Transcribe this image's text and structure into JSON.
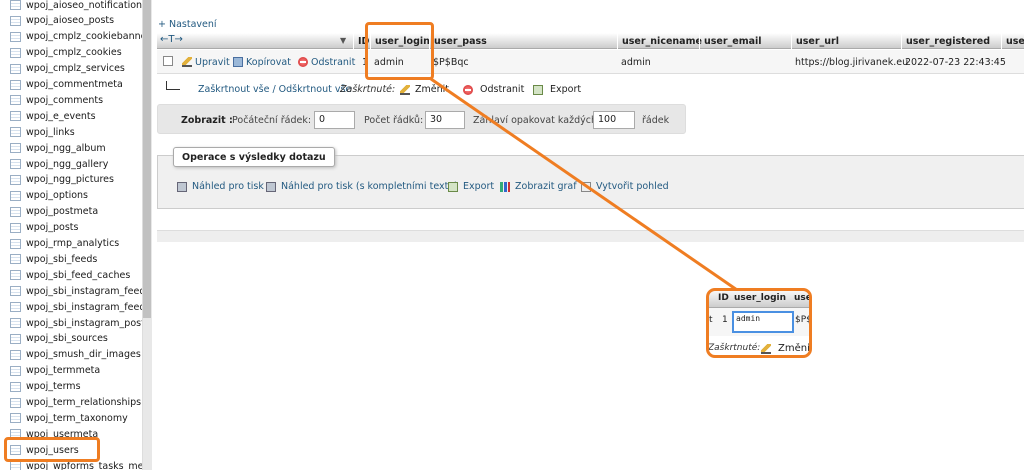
{
  "sidebar": {
    "tables": [
      "wpoj_aioseo_notifications",
      "wpoj_aioseo_posts",
      "wpoj_cmplz_cookiebanners",
      "wpoj_cmplz_cookies",
      "wpoj_cmplz_services",
      "wpoj_commentmeta",
      "wpoj_comments",
      "wpoj_e_events",
      "wpoj_links",
      "wpoj_ngg_album",
      "wpoj_ngg_gallery",
      "wpoj_ngg_pictures",
      "wpoj_options",
      "wpoj_postmeta",
      "wpoj_posts",
      "wpoj_rmp_analytics",
      "wpoj_sbi_feeds",
      "wpoj_sbi_feed_caches",
      "wpoj_sbi_instagram_feeds",
      "wpoj_sbi_instagram_feed_",
      "wpoj_sbi_instagram_posts",
      "wpoj_sbi_sources",
      "wpoj_smush_dir_images",
      "wpoj_termmeta",
      "wpoj_terms",
      "wpoj_term_relationships",
      "wpoj_term_taxonomy",
      "wpoj_usermeta",
      "wpoj_users",
      "wpoj_wpforms_tasks_meta"
    ],
    "selected": "wpoj_users"
  },
  "options_link": "+ Nastavení",
  "arrows": "←T→",
  "columns": [
    "ID",
    "user_login",
    "user_pass",
    "user_nicename",
    "user_email",
    "user_url",
    "user_registered",
    "use"
  ],
  "row": {
    "actions": {
      "edit": "Upravit",
      "copy": "Kopírovat",
      "delete": "Odstranit"
    },
    "id": "1",
    "user_login": "admin",
    "user_pass": "$P$Bqc",
    "user_nicename": "admin",
    "user_email": "",
    "user_url": "https://blog.jirivanek.eu",
    "user_registered": "2022-07-23 22:43:45"
  },
  "bulk": {
    "check_all": "Zaškrtnout vše / Odškrtnout vše",
    "checked_label": "Zaškrtnuté:",
    "change": "Změnit",
    "delete": "Odstranit",
    "export": "Export"
  },
  "nav": {
    "show": "Zobrazit :",
    "start_row_label": "Počáteční řádek:",
    "start_row": "0",
    "rows_count_label": "Počet řádků:",
    "rows_count": "30",
    "repeat_label": "Záhlaví opakovat každých",
    "repeat": "100",
    "rows_unit": "řádek"
  },
  "query_ops": {
    "legend": "Operace s výsledky dotazu",
    "print": "Náhled pro tisk",
    "print_full": "Náhled pro tisk (s kompletními texty)",
    "export": "Export",
    "chart": "Zobrazit graf",
    "view": "Vytvořit pohled"
  },
  "zoom": {
    "col_id": "ID",
    "col_login": "user_login",
    "col_next": "use",
    "row_prefix": "t",
    "id": "1",
    "login_value": "admin",
    "pass_fragment": "$P$",
    "checked_label": "Zaškrtnuté:",
    "change": "Změni"
  },
  "colors": {
    "highlight": "#ef7d22",
    "link": "#235a81"
  }
}
